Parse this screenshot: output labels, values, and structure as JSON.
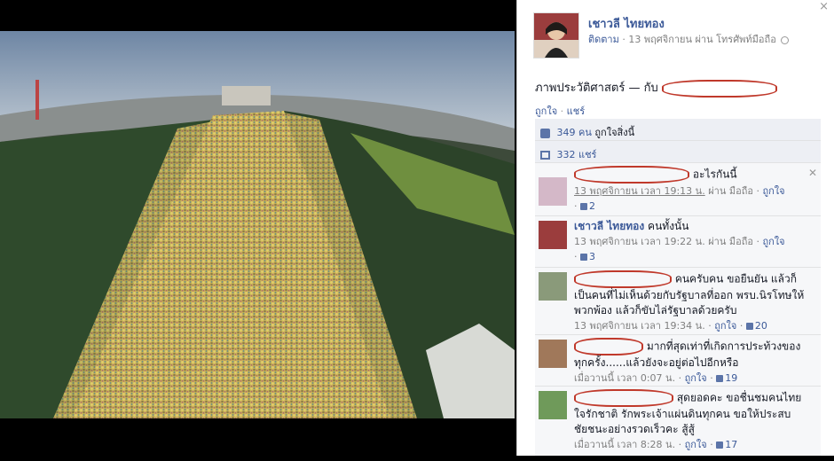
{
  "close_label": "×",
  "poster": {
    "name": "เชาวลี ไทยทอง",
    "follow": "ติดตาม",
    "date": "13 พฤศจิกายน ผ่าน โทรศัพท์มือถือ"
  },
  "post": {
    "caption": "ภาพประวัติศาสตร์ — กับ",
    "like": "ถูกใจ",
    "share": "แชร์"
  },
  "likes": {
    "count": "349 คน",
    "text": "ถูกใจสิ่งนี้"
  },
  "shares": {
    "text": "332 แชร์"
  },
  "comments": [
    {
      "author": "",
      "text": "อะไรกันนี้",
      "time": "13 พฤศจิกายน เวลา 19:13 น.",
      "via": "ผ่าน มือถือ",
      "like": "ถูกใจ",
      "likes": "2"
    },
    {
      "author": "เชาวลี ไทยทอง",
      "text": "คนทั้งนั้น",
      "time": "13 พฤศจิกายน เวลา 19:22 น.",
      "via": "ผ่าน มือถือ",
      "like": "ถูกใจ",
      "likes": "3"
    },
    {
      "author": "",
      "text": "คนครับคน ขอยืนยัน แล้วก็เป็นคนที่ไม่เห็นด้วยกับรัฐบาลที่ออก พรบ.นิรโทษให้พวกพ้อง แล้วก็ขับไล่รัฐบาลด้วยครับ",
      "time": "13 พฤศจิกายน เวลา 19:34 น.",
      "via": "",
      "like": "ถูกใจ",
      "likes": "20"
    },
    {
      "author": "",
      "text": "มากที่สุดเท่าที่เกิดการประท้วงของทุกครั้ง......แล้วยังจะอยู่ต่อไปอีกหรือ",
      "time": "เมื่อวานนี้ เวลา 0:07 น.",
      "via": "",
      "like": "ถูกใจ",
      "likes": "19"
    },
    {
      "author": "",
      "text": "สุดยอดคะ ขอชื่นชมคนไทยใจรักชาติ รักพระเจ้าแผ่นดินทุกคน ขอให้ประสบชัยชนะอย่างรวดเร็วคะ สู้สู้",
      "time": "เมื่อวานนี้ เวลา 8:28 น.",
      "via": "",
      "like": "ถูกใจ",
      "likes": "17"
    }
  ],
  "colors": {
    "link": "#3b5998",
    "redact": "#c0392b",
    "panel_bg": "#edeff4"
  }
}
